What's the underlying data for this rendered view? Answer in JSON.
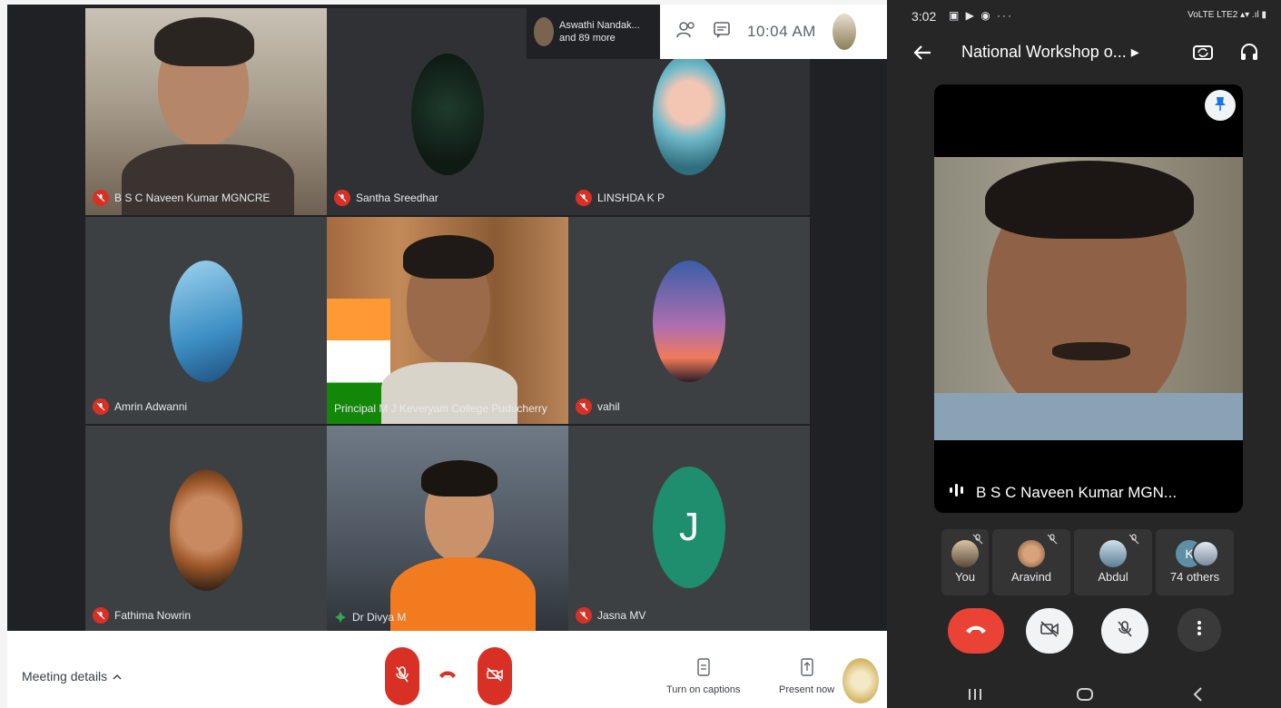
{
  "desktop": {
    "tiles": [
      {
        "name": "B S C Naveen Kumar MGNCRE",
        "mic": "off"
      },
      {
        "name": "Santha Sreedhar",
        "mic": "off"
      },
      {
        "name": "LINSHDA K P",
        "mic": "off"
      },
      {
        "name": "Amrin Adwanni",
        "mic": "off"
      },
      {
        "name": "Principal M J Keveryam College Puducherry",
        "mic": "none"
      },
      {
        "name": "vahil",
        "mic": "off"
      },
      {
        "name": "Fathima Nowrin",
        "mic": "off"
      },
      {
        "name": "Dr Divya M",
        "mic": "on"
      },
      {
        "name": "Jasna MV",
        "mic": "off",
        "initial": "J"
      }
    ],
    "top_strip": {
      "line1": "Aswathi Nandak...",
      "line2": "and 89 more"
    },
    "top_bar": {
      "time": "10:04 AM"
    },
    "bottom": {
      "meeting_details": "Meeting details",
      "captions_label": "Turn on captions",
      "present_label": "Present now"
    }
  },
  "phone": {
    "status_time": "3:02",
    "status_icons": "▣ ▶ ◉  ···",
    "status_right": "VoLTE LTE2 ▴▾ .ıl ▮",
    "meeting_title": "National Workshop o... ▸",
    "speaker": "B S C Naveen Kumar MGN...",
    "participants": [
      {
        "label": "You"
      },
      {
        "label": "Aravind"
      },
      {
        "label": "Abdul"
      },
      {
        "label": "74 others",
        "initial": "K"
      }
    ]
  },
  "colors": {
    "meet_bg": "#202124",
    "tile_bg": "#3c4043",
    "danger": "#d93025",
    "phone_bg": "#262626"
  }
}
